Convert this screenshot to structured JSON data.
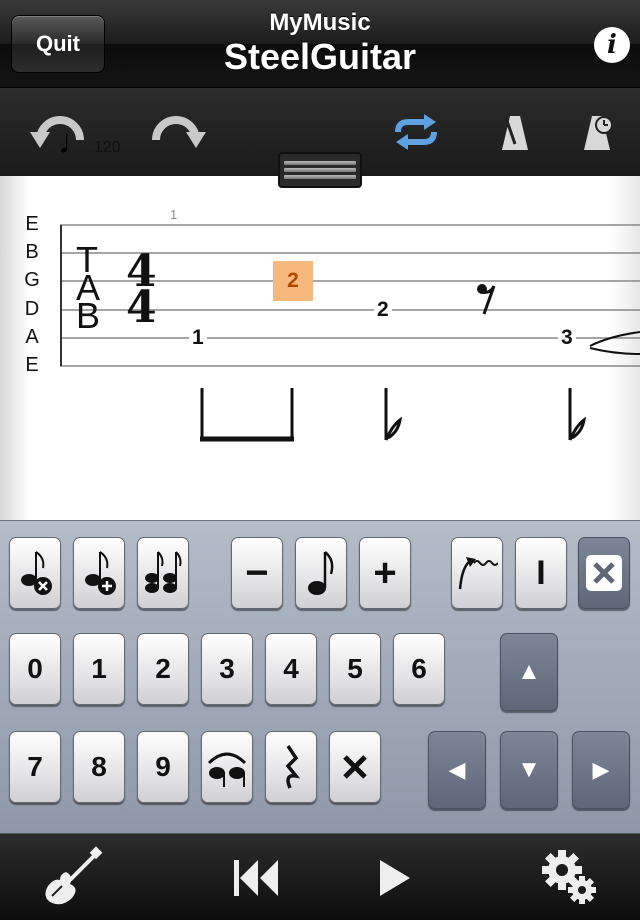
{
  "nav": {
    "quit_label": "Quit",
    "subtitle": "MyMusic",
    "title": "SteelGuitar",
    "info_label": "i"
  },
  "toolbar": {
    "tempo": "120",
    "tempo_note_glyph": "♩",
    "icons": [
      "undo-icon",
      "redo-icon",
      "loop-icon",
      "metronome-icon",
      "metronome-timer-icon"
    ],
    "loop_color": "#5fa0e0"
  },
  "score": {
    "measure_number": "1",
    "strings": [
      "E",
      "B",
      "G",
      "D",
      "A",
      "E"
    ],
    "clef": "TAB",
    "time_signature": {
      "top": "4",
      "bottom": "4"
    },
    "notes": [
      {
        "string": "A",
        "fret": "1",
        "selected": false
      },
      {
        "string": "G",
        "fret": "2",
        "selected": true
      },
      {
        "string": "D",
        "fret": "2",
        "selected": false
      },
      {
        "string": "G",
        "fret": "",
        "rest": true
      },
      {
        "string": "A",
        "fret": "3",
        "selected": false
      }
    ],
    "selected_color": "#f7b87d"
  },
  "keypad": {
    "row1": [
      "delete-note-icon",
      "add-note-icon",
      "chord-icon",
      "−",
      "eighth-note-icon",
      "+",
      "bend-icon",
      "I",
      "delete-icon"
    ],
    "digits_row2": [
      "0",
      "1",
      "2",
      "3",
      "4",
      "5",
      "6"
    ],
    "digits_row3": [
      "7",
      "8",
      "9"
    ],
    "row3_extras": [
      "tie-icon",
      "rest-icon",
      "dead-note-icon"
    ],
    "arrows": {
      "up": "▲",
      "left": "◀",
      "down": "▼",
      "right": "▶"
    }
  },
  "bottom": {
    "icons": [
      "guitar-icon",
      "rewind-icon",
      "play-icon",
      "settings-icon"
    ]
  }
}
